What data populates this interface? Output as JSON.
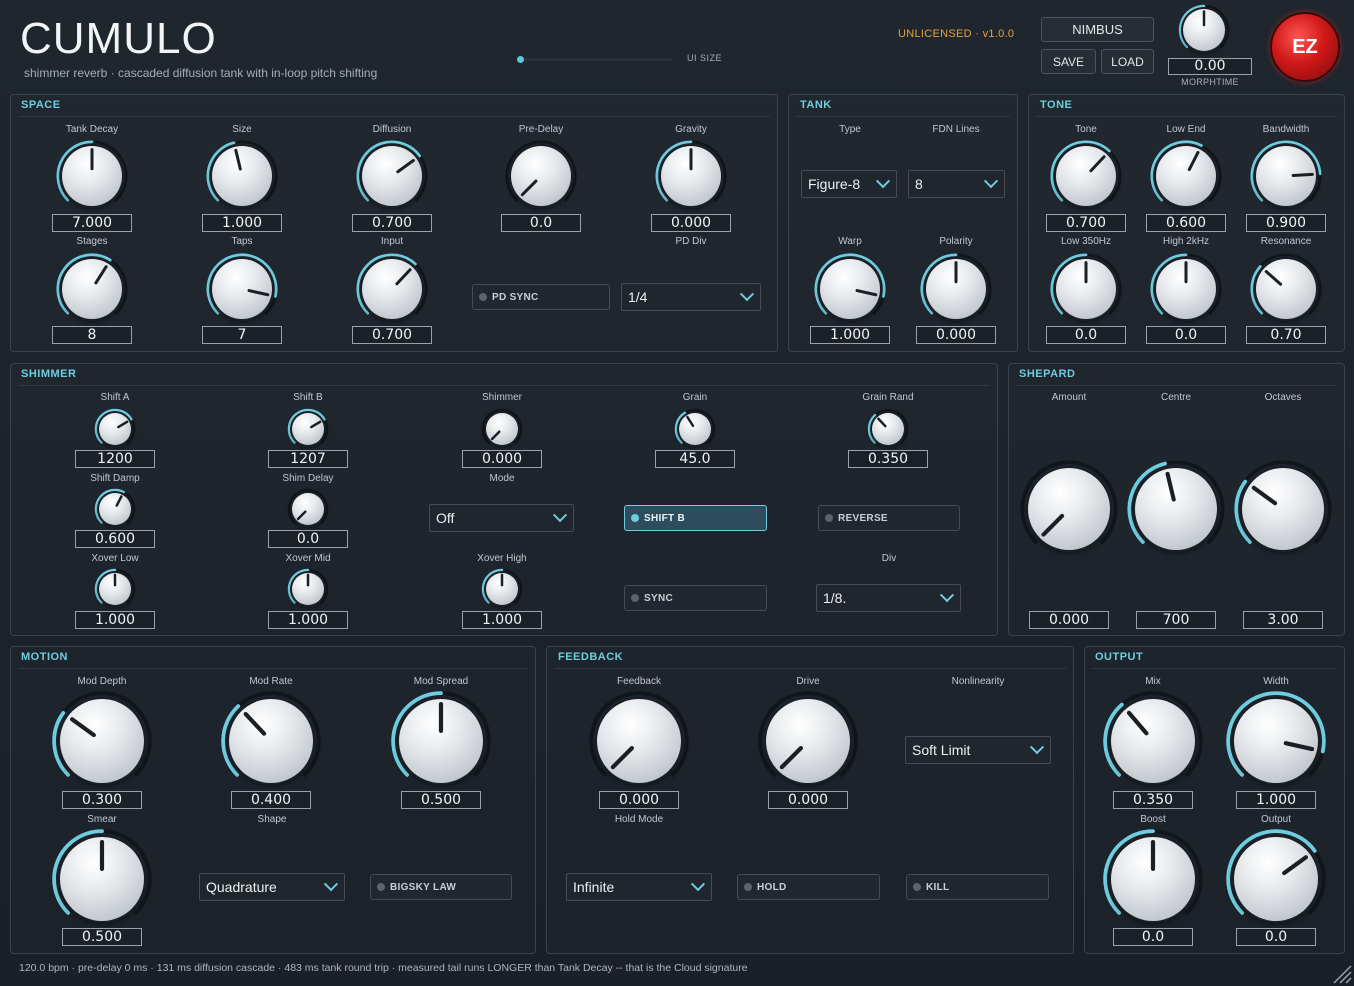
{
  "app": {
    "title": "CUMULO",
    "subtitle": "shimmer reverb  ·  cascaded diffusion tank with in-loop pitch shifting",
    "ui_size_label": "UI SIZE",
    "ui_size": 0.0,
    "license": "UNLICENSED  ·  v1.0.0",
    "preset": "NIMBUS",
    "save": "SAVE",
    "load": "LOAD",
    "morph_value": "0.00",
    "morph_label": "MORPHTIME",
    "morph_knob": 0.5,
    "ez": "EZ",
    "accent": "#6fcde0",
    "license_color": "#e8a23a"
  },
  "panels": {
    "space": "SPACE",
    "tank": "TANK",
    "tone": "TONE",
    "shimmer": "SHIMMER",
    "shepard": "SHEPARD",
    "motion": "MOTION",
    "feedback": "FEEDBACK",
    "output": "OUTPUT"
  },
  "knobs": [
    {
      "id": "tank-decay",
      "label": "Tank Decay",
      "value": "7.000",
      "norm": 0.5
    },
    {
      "id": "size",
      "label": "Size",
      "value": "1.000",
      "norm": 0.45
    },
    {
      "id": "diffusion",
      "label": "Diffusion",
      "value": "0.700",
      "norm": 0.7
    },
    {
      "id": "pre-delay",
      "label": "Pre-Delay",
      "value": "0.0",
      "norm": 0.0
    },
    {
      "id": "gravity",
      "label": "Gravity",
      "value": "0.000",
      "norm": 0.5
    },
    {
      "id": "stages",
      "label": "Stages",
      "value": "8",
      "norm": 0.62
    },
    {
      "id": "taps",
      "label": "Taps",
      "value": "7",
      "norm": 0.88
    },
    {
      "id": "input",
      "label": "Input",
      "value": "0.700",
      "norm": 0.66
    },
    {
      "id": "warp",
      "label": "Warp",
      "value": "1.000",
      "norm": 0.88
    },
    {
      "id": "polarity",
      "label": "Polarity",
      "value": "0.000",
      "norm": 0.5
    },
    {
      "id": "tone",
      "label": "Tone",
      "value": "0.700",
      "norm": 0.66
    },
    {
      "id": "low-end",
      "label": "Low End",
      "value": "0.600",
      "norm": 0.6
    },
    {
      "id": "bandwidth",
      "label": "Bandwidth",
      "value": "0.900",
      "norm": 0.82
    },
    {
      "id": "low-350",
      "label": "Low 350Hz",
      "value": "0.0",
      "norm": 0.5
    },
    {
      "id": "high-2k",
      "label": "High 2kHz",
      "value": "0.0",
      "norm": 0.5
    },
    {
      "id": "resonance",
      "label": "Resonance",
      "value": "0.70",
      "norm": 0.32
    },
    {
      "id": "shift-a",
      "label": "Shift A",
      "value": "1200",
      "norm": 0.72
    },
    {
      "id": "shift-b",
      "label": "Shift B",
      "value": "1207",
      "norm": 0.72
    },
    {
      "id": "shimmer",
      "label": "Shimmer",
      "value": "0.000",
      "norm": 0.0
    },
    {
      "id": "grain",
      "label": "Grain",
      "value": "45.0",
      "norm": 0.38
    },
    {
      "id": "grain-rand",
      "label": "Grain Rand",
      "value": "0.350",
      "norm": 0.34
    },
    {
      "id": "shift-damp",
      "label": "Shift Damp",
      "value": "0.600",
      "norm": 0.6
    },
    {
      "id": "shim-delay",
      "label": "Shim Delay",
      "value": "0.0",
      "norm": 0.0
    },
    {
      "id": "xover-low",
      "label": "Xover Low",
      "value": "1.000",
      "norm": 0.5
    },
    {
      "id": "xover-mid",
      "label": "Xover Mid",
      "value": "1.000",
      "norm": 0.5
    },
    {
      "id": "xover-high",
      "label": "Xover High",
      "value": "1.000",
      "norm": 0.5
    },
    {
      "id": "amount",
      "label": "Amount",
      "value": "0.000",
      "norm": 0.0
    },
    {
      "id": "centre",
      "label": "Centre",
      "value": "700",
      "norm": 0.45
    },
    {
      "id": "octaves",
      "label": "Octaves",
      "value": "3.00",
      "norm": 0.3
    },
    {
      "id": "mod-depth",
      "label": "Mod Depth",
      "value": "0.300",
      "norm": 0.3
    },
    {
      "id": "mod-rate",
      "label": "Mod Rate",
      "value": "0.400",
      "norm": 0.34
    },
    {
      "id": "mod-spread",
      "label": "Mod Spread",
      "value": "0.500",
      "norm": 0.5
    },
    {
      "id": "smear",
      "label": "Smear",
      "value": "0.500",
      "norm": 0.5
    },
    {
      "id": "feedback",
      "label": "Feedback",
      "value": "0.000",
      "norm": 0.0
    },
    {
      "id": "drive",
      "label": "Drive",
      "value": "0.000",
      "norm": 0.0
    },
    {
      "id": "mix",
      "label": "Mix",
      "value": "0.350",
      "norm": 0.35
    },
    {
      "id": "width",
      "label": "Width",
      "value": "1.000",
      "norm": 0.88
    },
    {
      "id": "boost",
      "label": "Boost",
      "value": "0.0",
      "norm": 0.5
    },
    {
      "id": "output",
      "label": "Output",
      "value": "0.0",
      "norm": 0.7
    }
  ],
  "labels": {
    "type": "Type",
    "fdn_lines": "FDN Lines",
    "pd_div": "PD Div",
    "mode": "Mode",
    "div": "Div",
    "shape": "Shape",
    "hold_mode": "Hold Mode",
    "nonlinearity": "Nonlinearity"
  },
  "dropdowns": {
    "type": "Figure-8",
    "fdn_lines": "8",
    "pd_div": "1/4",
    "mode": "Off",
    "div": "1/8.",
    "shape": "Quadrature",
    "hold_mode": "Infinite",
    "nonlinearity": "Soft Limit"
  },
  "toggles": {
    "pd_sync": {
      "label": "PD SYNC",
      "on": false
    },
    "shift_b": {
      "label": "SHIFT B",
      "on": true
    },
    "reverse": {
      "label": "REVERSE",
      "on": false
    },
    "sync": {
      "label": "SYNC",
      "on": false
    },
    "bigsky": {
      "label": "BIGSKY LAW",
      "on": false
    },
    "hold": {
      "label": "HOLD",
      "on": false
    },
    "kill": {
      "label": "KILL",
      "on": false
    }
  },
  "footer": "120.0 bpm  ·  pre-delay 0 ms  ·  131 ms diffusion cascade  ·  483 ms tank round trip  ·  measured tail runs LONGER than Tank Decay -- that is the Cloud signature"
}
